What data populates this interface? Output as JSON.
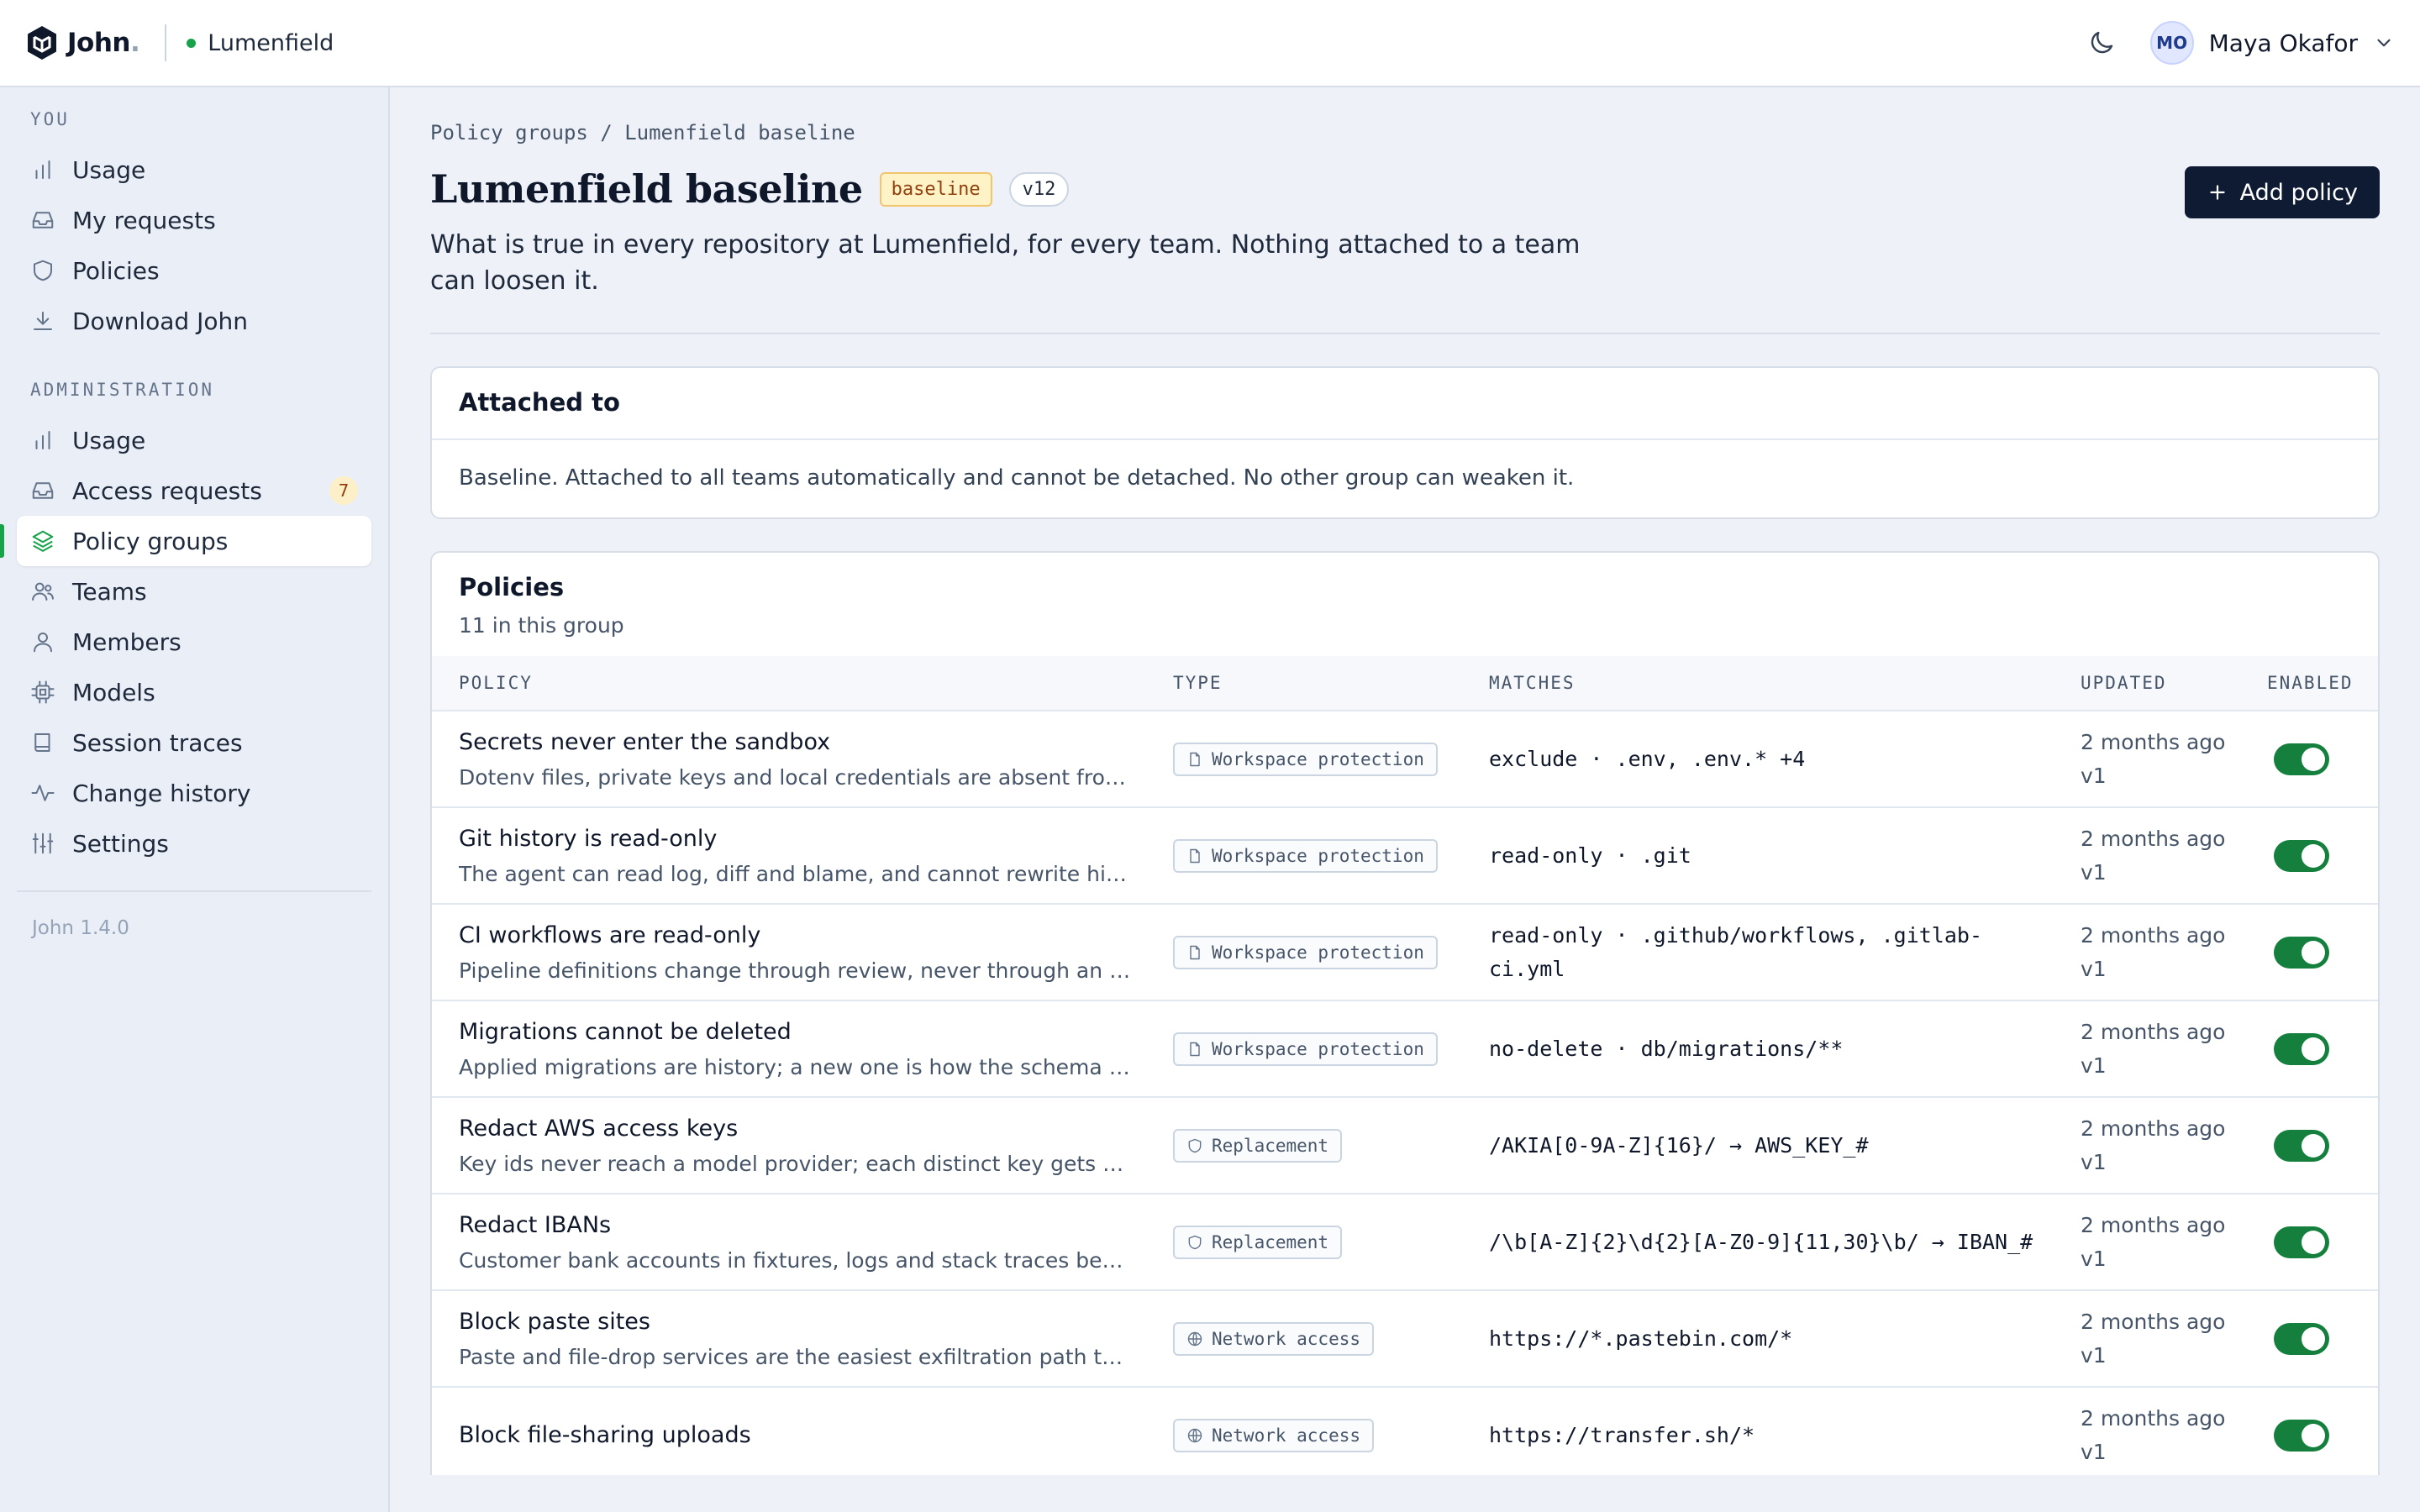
{
  "header": {
    "brand": "John",
    "brand_dot": ".",
    "org": "Lumenfield",
    "user_initials": "MO",
    "user_name": "Maya Okafor"
  },
  "sidebar": {
    "you_label": "YOU",
    "you_items": [
      {
        "label": "Usage",
        "icon": "bar-chart-icon"
      },
      {
        "label": "My requests",
        "icon": "inbox-icon"
      },
      {
        "label": "Policies",
        "icon": "shield-icon"
      },
      {
        "label": "Download John",
        "icon": "download-icon"
      }
    ],
    "admin_label": "ADMINISTRATION",
    "admin_items": [
      {
        "label": "Usage",
        "icon": "bar-chart-icon"
      },
      {
        "label": "Access requests",
        "icon": "inbox-icon",
        "badge": "7"
      },
      {
        "label": "Policy groups",
        "icon": "layers-icon",
        "active": true
      },
      {
        "label": "Teams",
        "icon": "users-icon"
      },
      {
        "label": "Members",
        "icon": "user-icon"
      },
      {
        "label": "Models",
        "icon": "cpu-icon"
      },
      {
        "label": "Session traces",
        "icon": "book-icon"
      },
      {
        "label": "Change history",
        "icon": "activity-icon"
      },
      {
        "label": "Settings",
        "icon": "sliders-icon"
      }
    ],
    "version": "John 1.4.0"
  },
  "main": {
    "breadcrumb": "Policy groups / Lumenfield baseline",
    "title": "Lumenfield baseline",
    "tag": "baseline",
    "version": "v12",
    "add_button": "Add policy",
    "description": "What is true in every repository at Lumenfield, for every team. Nothing attached to a team can loosen it.",
    "attached": {
      "title": "Attached to",
      "body": "Baseline. Attached to all teams automatically and cannot be detached. No other group can weaken it."
    },
    "policies": {
      "title": "Policies",
      "subtitle": "11 in this group",
      "columns": {
        "policy": "POLICY",
        "type": "TYPE",
        "matches": "MATCHES",
        "updated": "UPDATED",
        "enabled": "ENABLED"
      },
      "rows": [
        {
          "name": "Secrets never enter the sandbox",
          "desc": "Dotenv files, private keys and local credentials are absent from ...",
          "type": "Workspace protection",
          "type_icon": "file-icon",
          "match": "exclude · .env, .env.* +4",
          "updated": "2 months ago",
          "ver": "v1",
          "enabled": true
        },
        {
          "name": "Git history is read-only",
          "desc": "The agent can read log, diff and blame, and cannot rewrite histo...",
          "type": "Workspace protection",
          "type_icon": "file-icon",
          "match": "read-only · .git",
          "updated": "2 months ago",
          "ver": "v1",
          "enabled": true
        },
        {
          "name": "CI workflows are read-only",
          "desc": "Pipeline definitions change through review, never through an ag...",
          "type": "Workspace protection",
          "type_icon": "file-icon",
          "match": "read-only · .github/workflows, .gitlab-ci.yml",
          "updated": "2 months ago",
          "ver": "v1",
          "enabled": true
        },
        {
          "name": "Migrations cannot be deleted",
          "desc": "Applied migrations are history; a new one is how the schema ch...",
          "type": "Workspace protection",
          "type_icon": "file-icon",
          "match": "no-delete · db/migrations/**",
          "updated": "2 months ago",
          "ver": "v1",
          "enabled": true
        },
        {
          "name": "Redact AWS access keys",
          "desc": "Key ids never reach a model provider; each distinct key gets a s...",
          "type": "Replacement",
          "type_icon": "shield-icon",
          "match": "/AKIA[0-9A-Z]{16}/ → AWS_KEY_#",
          "updated": "2 months ago",
          "ver": "v1",
          "enabled": true
        },
        {
          "name": "Redact IBANs",
          "desc": "Customer bank accounts in fixtures, logs and stack traces beco...",
          "type": "Replacement",
          "type_icon": "shield-icon",
          "match": "/\\b[A-Z]{2}\\d{2}[A-Z0-9]{11,30}\\b/ → IBAN_#",
          "updated": "2 months ago",
          "ver": "v1",
          "enabled": true
        },
        {
          "name": "Block paste sites",
          "desc": "Paste and file-drop services are the easiest exfiltration path ther...",
          "type": "Network access",
          "type_icon": "globe-icon",
          "match": "https://*.pastebin.com/*",
          "updated": "2 months ago",
          "ver": "v1",
          "enabled": true
        },
        {
          "name": "Block file-sharing uploads",
          "desc": "",
          "type": "Network access",
          "type_icon": "globe-icon",
          "match": "https://transfer.sh/*",
          "updated": "2 months ago",
          "ver": "v1",
          "enabled": true
        }
      ]
    }
  }
}
